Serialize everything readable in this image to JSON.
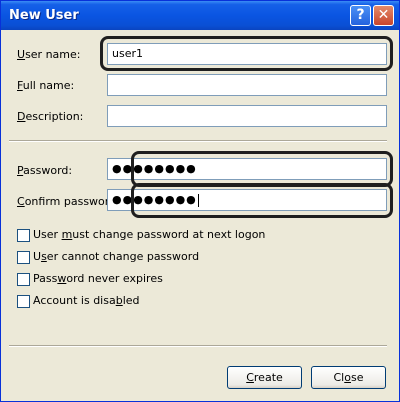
{
  "window": {
    "title": "New User",
    "help_glyph": "?",
    "close_glyph": "✕"
  },
  "form": {
    "user_name": {
      "label_pre": "",
      "label_ul": "U",
      "label_post": "ser name:",
      "value": "user1"
    },
    "full_name": {
      "label_pre": "",
      "label_ul": "F",
      "label_post": "ull name:",
      "value": ""
    },
    "description": {
      "label_pre": "",
      "label_ul": "D",
      "label_post": "escription:",
      "value": ""
    },
    "password": {
      "label_pre": "",
      "label_ul": "P",
      "label_post": "assword:",
      "value": "●●●●●●●●"
    },
    "confirm_password": {
      "label_pre": "",
      "label_ul": "C",
      "label_post": "onfirm password:",
      "value": "●●●●●●●●"
    }
  },
  "options": [
    {
      "pre": "User ",
      "ul": "m",
      "post": "ust change password at next logon",
      "checked": false
    },
    {
      "pre": "U",
      "ul": "s",
      "post": "er cannot change password",
      "checked": false
    },
    {
      "pre": "Pass",
      "ul": "w",
      "post": "ord never expires",
      "checked": false
    },
    {
      "pre": "Account is disa",
      "ul": "b",
      "post": "led",
      "checked": false
    }
  ],
  "buttons": {
    "create": {
      "pre": "",
      "ul": "C",
      "post": "reate"
    },
    "close": {
      "pre": "Cl",
      "ul": "o",
      "post": "se"
    }
  },
  "colors": {
    "titlebar": "#0a55e2",
    "window_bg": "#ece9d8",
    "field_border": "#7f9db9"
  }
}
